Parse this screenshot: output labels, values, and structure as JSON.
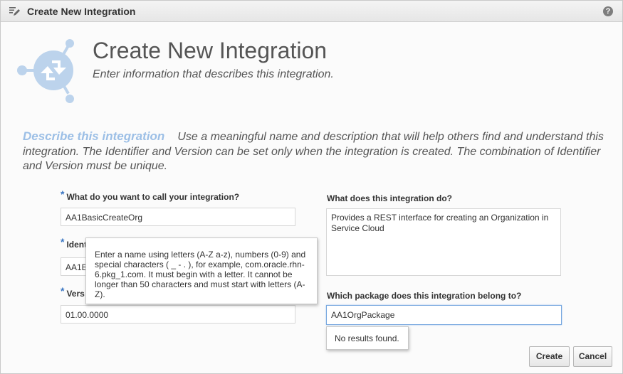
{
  "window": {
    "title": "Create New Integration",
    "help_glyph": "?"
  },
  "header": {
    "title": "Create New Integration",
    "subtitle": "Enter information that describes this integration."
  },
  "describe": {
    "lead": "Describe this integration",
    "text": "Use a meaningful name and description that will help others find and understand this integration. The Identifier and Version can be set only when the integration is created. The combination of Identifier and Version must be unique."
  },
  "form": {
    "required_marker": "*",
    "name": {
      "label": "What do you want to call your integration?",
      "value": "AA1BasicCreateOrg"
    },
    "identifier": {
      "label": "Ident",
      "value": "AA1B"
    },
    "version": {
      "label": "Vers",
      "value": "01.00.0000"
    },
    "description": {
      "label": "What does this integration do?",
      "value": "Provides a REST interface for creating an Organization in Service Cloud"
    },
    "package": {
      "label": "Which package does this integration belong to?",
      "value": "AA1OrgPackage"
    }
  },
  "tooltip": {
    "text": "Enter a name using letters (A-Z a-z), numbers (0-9) and special characters ( _ - . ), for example, com.oracle.rhn-6.pkg_1.com. It must begin with a letter. It cannot be longer than 50 characters and must start with letters (A-Z)."
  },
  "package_popup": {
    "text": "No results found."
  },
  "buttons": {
    "create": "Create",
    "cancel": "Cancel"
  },
  "colors": {
    "accent": "#9cbfe6",
    "icon": "#a9c6e6",
    "focus_border": "#76a7df"
  },
  "icons": {
    "title": "edit-pencil-icon",
    "hero": "integration-icon",
    "help": "help-icon"
  }
}
